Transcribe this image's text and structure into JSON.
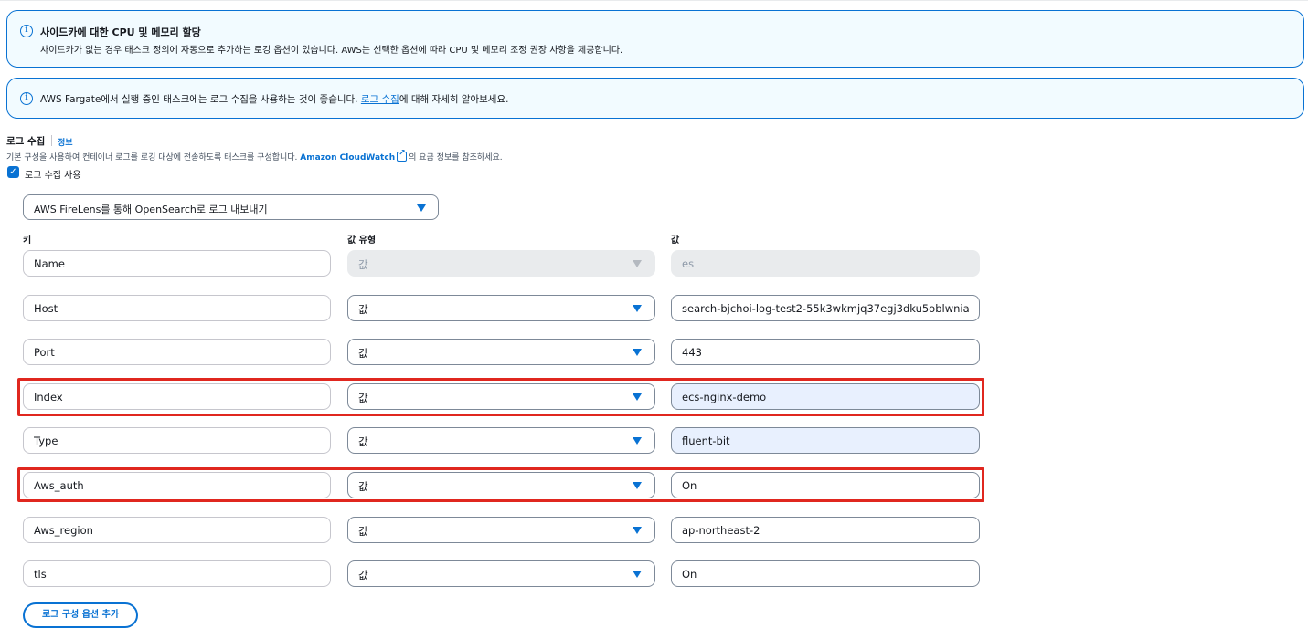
{
  "alerts": {
    "sidecar": {
      "title": "사이드카에 대한 CPU 및 메모리 할당",
      "body": "사이드카가 없는 경우 태스크 정의에 자동으로 추가하는 로깅 옵션이 있습니다. AWS는 선택한 옵션에 따라 CPU 및 메모리 조정 권장 사항을 제공합니다."
    },
    "fargate": {
      "text_before": "AWS Fargate에서 실행 중인 태스크에는 로그 수집을 사용하는 것이 좋습니다. ",
      "link": "로그 수집",
      "text_after": "에 대해 자세히 알아보세요."
    }
  },
  "log_collection": {
    "title": "로그 수집",
    "info_link": "정보",
    "desc_before": "기본 구성을 사용하여 컨테이너 로그를 로깅 대상에 전송하도록 태스크를 구성합니다. ",
    "desc_link": "Amazon CloudWatch",
    "desc_after": "의 요금 정보를 참조하세요.",
    "checkbox_label": "로그 수집 사용",
    "checkbox_checked": true,
    "destination": "AWS FireLens를 통해 OpenSearch로 로그 내보내기"
  },
  "columns": {
    "key": "키",
    "value_type": "값 유형",
    "value": "값"
  },
  "options": [
    {
      "key": "Name",
      "value_type": "값",
      "value": "es",
      "disabled": true
    },
    {
      "key": "Host",
      "value_type": "값",
      "value": "search-bjchoi-log-test2-55k3wkmjq37egj3dku5oblwnia"
    },
    {
      "key": "Port",
      "value_type": "값",
      "value": "443"
    },
    {
      "key": "Index",
      "value_type": "값",
      "value": "ecs-nginx-demo",
      "highlighted": true
    },
    {
      "key": "Type",
      "value_type": "값",
      "value": "fluent-bit"
    },
    {
      "key": "Aws_auth",
      "value_type": "값",
      "value": "On",
      "highlighted": true
    },
    {
      "key": "Aws_region",
      "value_type": "값",
      "value": "ap-northeast-2"
    },
    {
      "key": "tls",
      "value_type": "값",
      "value": "On"
    }
  ],
  "add_option_button": "로그 구성 옵션 추가",
  "colors": {
    "accent": "#0972d3",
    "highlight_border": "#e0271f",
    "alert_bg": "#f2fbff"
  }
}
